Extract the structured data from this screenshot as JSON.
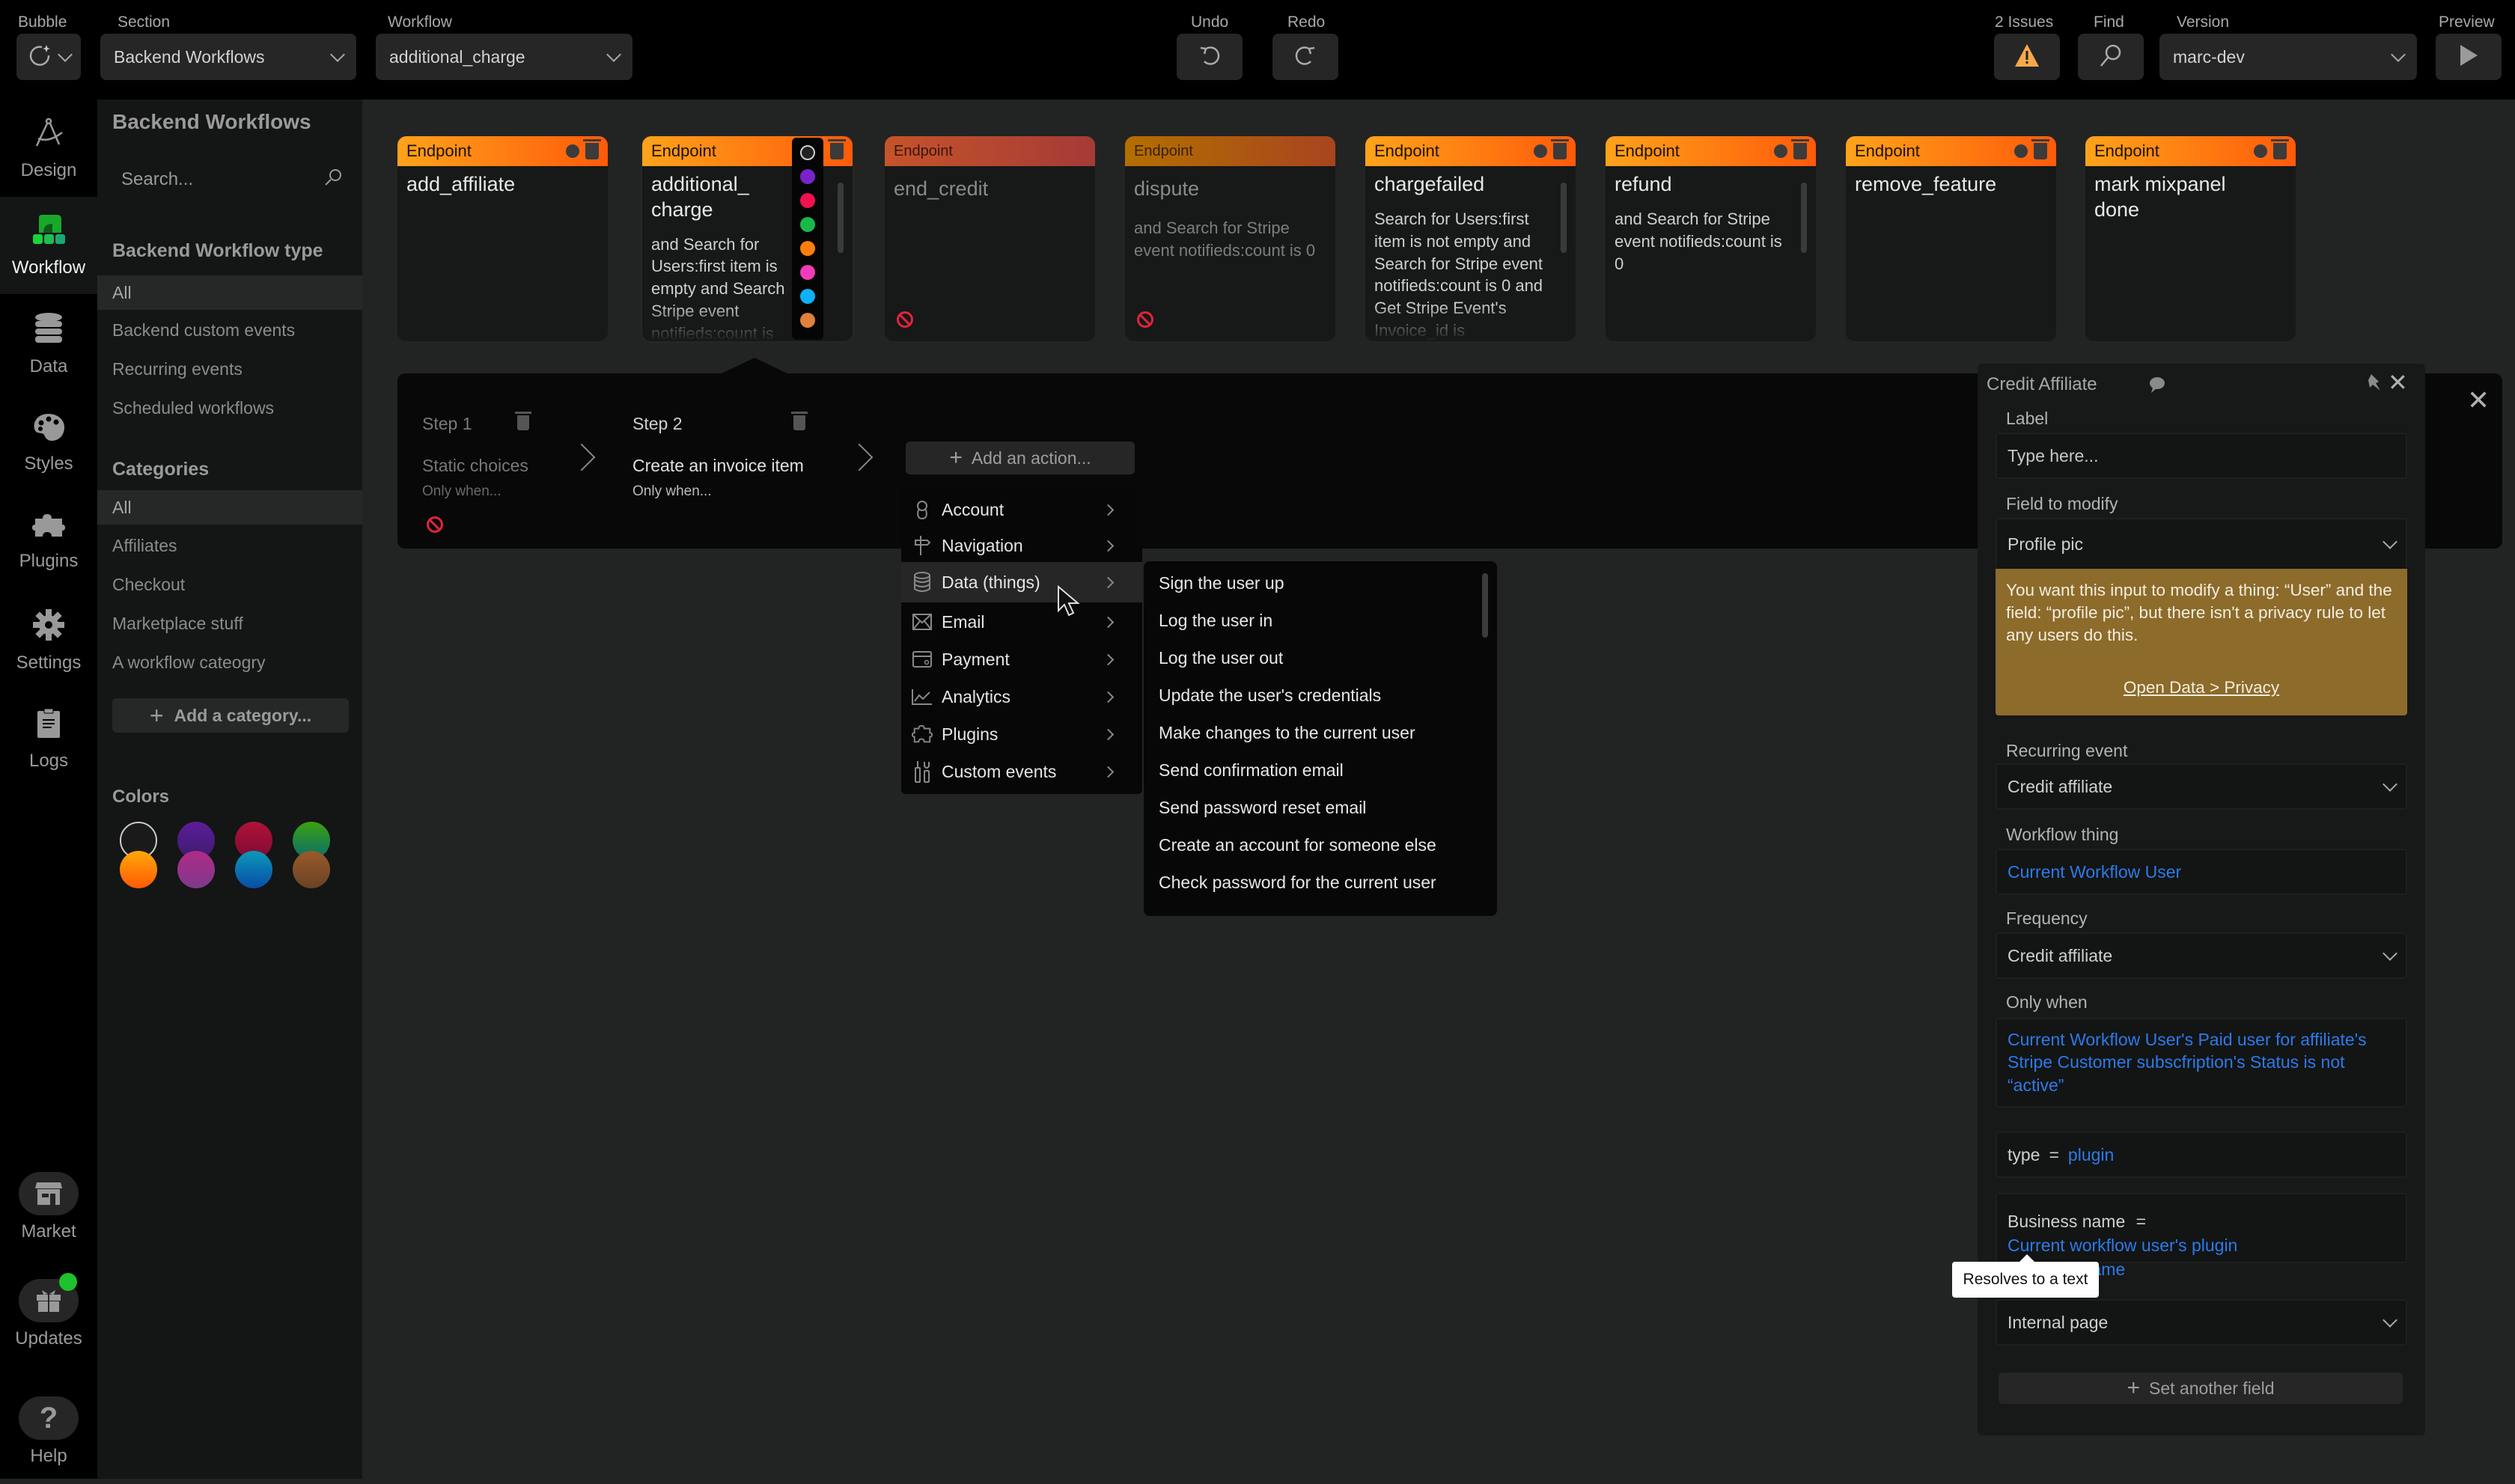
{
  "topbar": {
    "bubble_label": "Bubble",
    "section_label": "Section",
    "section_value": "Backend Workflows",
    "workflow_label": "Workflow",
    "workflow_value": "additional_charge",
    "undo_label": "Undo",
    "redo_label": "Redo",
    "issues_label": "2 Issues",
    "find_label": "Find",
    "version_label": "Version",
    "version_value": "marc-dev",
    "preview_label": "Preview"
  },
  "rail": {
    "items": [
      {
        "label": "Design",
        "icon": "compass-icon"
      },
      {
        "label": "Workflow",
        "icon": "workflow-icon",
        "active": true
      },
      {
        "label": "Data",
        "icon": "database-icon"
      },
      {
        "label": "Styles",
        "icon": "palette-icon"
      },
      {
        "label": "Plugins",
        "icon": "puzzle-icon"
      },
      {
        "label": "Settings",
        "icon": "gear-icon"
      },
      {
        "label": "Logs",
        "icon": "clipboard-icon"
      }
    ],
    "bottom": [
      {
        "label": "Market",
        "icon": "store-icon"
      },
      {
        "label": "Updates",
        "icon": "gift-icon",
        "badge_color": "#1fc12c"
      },
      {
        "label": "Help",
        "icon": "question-icon"
      }
    ]
  },
  "sidebar": {
    "title": "Backend Workflows",
    "search_placeholder": "Search...",
    "type_heading": "Backend Workflow type",
    "types": [
      "All",
      "Backend custom events",
      "Recurring events",
      "Scheduled workflows"
    ],
    "categories_heading": "Categories",
    "categories": [
      "All",
      "Affiliates",
      "Checkout",
      "Marketplace stuff",
      "A workflow cateogry"
    ],
    "add_category": "Add a category...",
    "colors_heading": "Colors",
    "colors": [
      "none",
      "#5a1d96",
      "#a0103a",
      "#1c8a3a",
      "#ff7a00",
      "#9a2e88",
      "#0c72b8",
      "#8a4e24"
    ]
  },
  "cards": [
    {
      "header": "Endpoint",
      "title": "add_affiliate",
      "desc": "",
      "disabled": false
    },
    {
      "header": "Endpoint",
      "title": "additional_ charge",
      "desc": "and Search for Users:first item is empty and Search Stripe event notifieds:count is",
      "disabled": false,
      "selected": true
    },
    {
      "header": "Endpoint",
      "title": "end_credit",
      "desc": "",
      "disabled": true
    },
    {
      "header": "Endpoint",
      "title": "dispute",
      "desc": "and Search for Stripe event notifieds:count is 0",
      "disabled": true
    },
    {
      "header": "Endpoint",
      "title": "chargefailed",
      "desc": "Search for Users:first item is not empty and Search for Stripe event notifieds:count is 0 and Get Stripe Event's Invoice_id is",
      "disabled": false
    },
    {
      "header": "Endpoint",
      "title": "refund",
      "desc": "and Search for Stripe event notifieds:count is 0",
      "disabled": false
    },
    {
      "header": "Endpoint",
      "title": "remove_feature",
      "desc": "",
      "disabled": false
    },
    {
      "header": "Endpoint",
      "title": "mark mixpanel done",
      "desc": "",
      "disabled": false
    }
  ],
  "color_picker": [
    "none",
    "#7a22c9",
    "#f0114e",
    "#19b84a",
    "#ff7d0a",
    "#f03cb8",
    "#0fb0f5",
    "#e0803a"
  ],
  "steps": [
    {
      "label": "Step 1",
      "action": "Static choices",
      "condition": "Only when...",
      "disabled": true
    },
    {
      "label": "Step 2",
      "action": "Create an invoice item",
      "condition": "Only when...",
      "disabled": false
    }
  ],
  "add_action": "Add an action...",
  "action_menu": [
    {
      "label": "Account",
      "icon": "user-icon"
    },
    {
      "label": "Navigation",
      "icon": "signpost-icon"
    },
    {
      "label": "Data (things)",
      "icon": "database-icon",
      "hover": true
    },
    {
      "label": "Email",
      "icon": "envelope-icon"
    },
    {
      "label": "Payment",
      "icon": "card-icon"
    },
    {
      "label": "Analytics",
      "icon": "chart-icon"
    },
    {
      "label": "Plugins",
      "icon": "puzzle-icon"
    },
    {
      "label": "Custom events",
      "icon": "tools-icon"
    }
  ],
  "sub_menu": [
    "Sign the user up",
    "Log the user in",
    "Log the user out",
    "Update the user's credentials",
    "Make changes to the current user",
    "Send confirmation email",
    "Send password reset email",
    "Create an account for someone else",
    "Check password for the current user"
  ],
  "prop_panel": {
    "title": "Credit Affiliate",
    "label_label": "Label",
    "label_placeholder": "Type here...",
    "field_label": "Field to modify",
    "field_value": "Profile pic",
    "warning": "You want this input to modify a thing: “User” and the field: “profile pic”, but there isn't a privacy rule to let any users do this.",
    "warning_link": "Open Data  >  Privacy",
    "recurring_label": "Recurring event",
    "recurring_value": "Credit affiliate",
    "thing_label": "Workflow thing",
    "thing_value": "Current Workflow User",
    "frequency_label": "Frequency",
    "frequency_value": "Credit affiliate",
    "only_when_label": "Only when",
    "only_when_value": "Current Workflow User's Paid user for affiliate's Stripe Customer subscfription's Status is not “active”",
    "type_key": "type",
    "type_eq": "=",
    "type_value": "plugin",
    "business_key": "Business name",
    "business_eq": "=",
    "business_value": "Current workflow user's plugin Business name",
    "tooltip": "Resolves to a text",
    "page_value": "Internal page",
    "set_another": "Set another field"
  }
}
